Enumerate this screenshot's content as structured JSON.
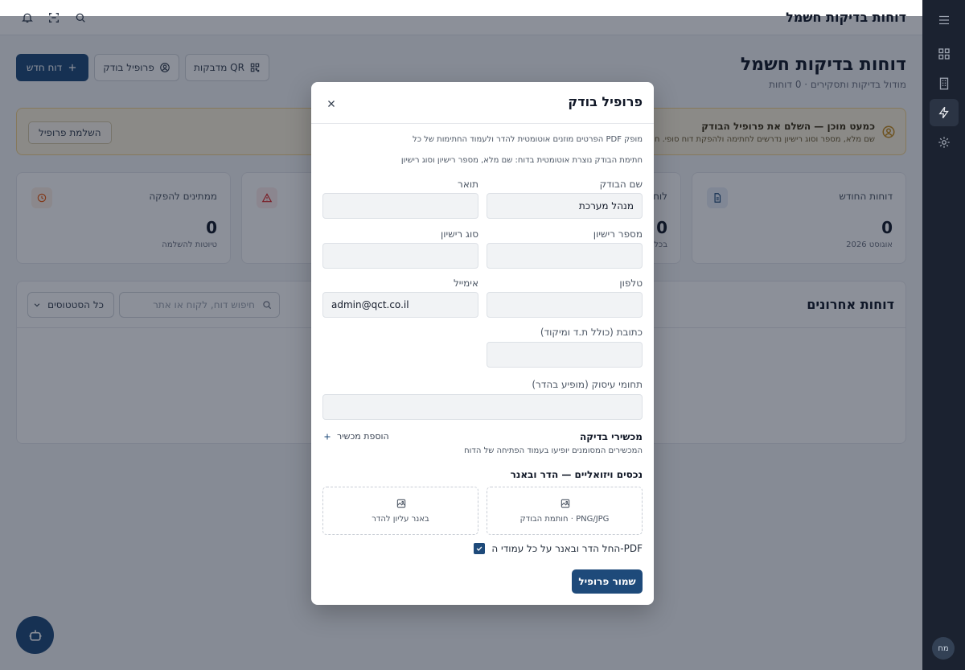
{
  "topbar": {
    "title": "דוחות בדיקות חשמל"
  },
  "header": {
    "title": "דוחות בדיקות חשמל",
    "subtitle": "מודול בדיקות ותסקירים · 0 דוחות",
    "new_report_label": "דוח חדש",
    "inspector_profile_label": "פרופיל בודק",
    "qr_stickers_label": "מדבקות QR"
  },
  "banner": {
    "title": "כמעט מוכן — השלם את פרופיל הבודק",
    "text": "שם מלא, מספר וסוג רישיון נדרשים לחתימה ולהפקת דוח סופי. חותמ",
    "button_label": "השלמת פרופיל"
  },
  "stats": [
    {
      "label": "דוחות החודש",
      "value": "0",
      "sub": "אוגוסט 2026"
    },
    {
      "label": "לוח",
      "value": "0",
      "sub": "בכל"
    },
    {
      "label": "",
      "value": "",
      "sub": ""
    },
    {
      "label": "ממתינים להפקה",
      "value": "0",
      "sub": "טיוטות להשלמה"
    }
  ],
  "recent": {
    "title": "דוחות אחרונים",
    "search_placeholder": "חיפוש דוח, לקוח או אתר",
    "status_filter": "כל הסטטוסים"
  },
  "sidebar": {
    "avatar": "מח"
  },
  "modal": {
    "title": "פרופיל בודק",
    "note1": "הפרטים מוזנים אוטומטית להדר ולעמוד החתימות של כל PDF מופק",
    "note2": "חתימת הבודק נוצרת אוטומטית בדוח: שם מלא, מספר רישיון וסוג רישיון",
    "fields": {
      "name_label": "שם הבודק",
      "name_value": "מנהל מערכת",
      "title_label": "תואר",
      "title_value": "",
      "license_no_label": "מספר רישיון",
      "license_no_value": "",
      "license_type_label": "סוג רישיון",
      "license_type_value": "",
      "phone_label": "טלפון",
      "phone_value": "",
      "email_label": "אימייל",
      "email_value": "admin@qct.co.il",
      "address_label": "כתובת (כולל ת.ד ומיקוד)",
      "address_value": "",
      "fields_label": "תחומי עיסוק (מופיע בהדר)",
      "fields_value": ""
    },
    "devices": {
      "title": "מכשירי בדיקה",
      "subtitle": "המכשירים המסומנים יופיעו בעמוד הפתיחה של הדוח",
      "add_label": "הוספת מכשיר"
    },
    "assets": {
      "title": "נכסים ויזואליים — הדר ובאנר",
      "stamp_label": "חותמת הבודק · PNG/JPG",
      "banner_label": "באנר עליון להדר"
    },
    "apply_all_label": "החל הדר ובאנר על כל עמודי ה-PDF",
    "apply_all_checked": true,
    "save_label": "שמור פרופיל"
  }
}
